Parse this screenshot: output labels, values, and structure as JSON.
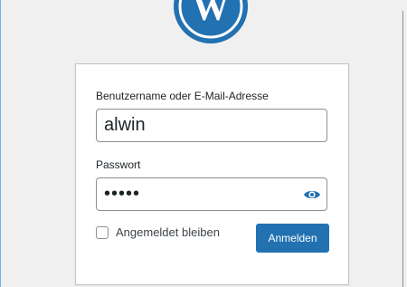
{
  "login": {
    "username_label": "Benutzername oder E-Mail-Adresse",
    "username_value": "alwin",
    "password_label": "Passwort",
    "password_value": "•••••",
    "remember_label": "Angemeldet bleiben",
    "remember_checked": false,
    "submit_label": "Anmelden"
  },
  "icons": {
    "logo": "wordpress-logo",
    "show_password": "eye-icon"
  },
  "colors": {
    "accent": "#2271b1",
    "logo": "#2271b1",
    "focus_frame": "#72aee6"
  }
}
